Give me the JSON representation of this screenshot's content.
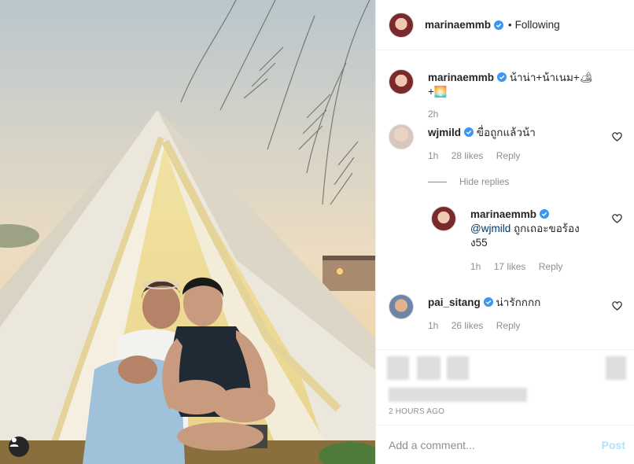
{
  "header": {
    "username": "marinaemmb",
    "separator": "•",
    "follow_status": "Following"
  },
  "caption": {
    "username": "marinaemmb",
    "text": "น้าน่า+น้าเนม+",
    "emoji_1": "🏕",
    "plus": "+",
    "emoji_2": "🌅",
    "time": "2h"
  },
  "comments": [
    {
      "username": "wjmild",
      "text": "ขื่อถูกแล้วน้า",
      "time": "1h",
      "likes": "28 likes",
      "reply": "Reply"
    },
    {
      "username": "marinaemmb",
      "mention": "@wjmild",
      "text": " ถูกเถอะขอร้อง",
      "text_2": "ง55",
      "time": "1h",
      "likes": "17 likes",
      "reply": "Reply"
    },
    {
      "username": "pai_sitang",
      "text": "น่ารักกกก",
      "time": "1h",
      "likes": "26 likes",
      "reply": "Reply"
    }
  ],
  "hide_replies": "Hide replies",
  "timestamp": "2 HOURS AGO",
  "add_comment": {
    "placeholder": "Add a comment...",
    "post_label": "Post"
  },
  "icons": {
    "verified": "verified-badge-icon",
    "heart": "heart-outline-icon",
    "user_tag": "user-tag-icon"
  },
  "colors": {
    "verified": "#3897f0",
    "link": "#00376b",
    "post_disabled": "#b2dffc"
  }
}
